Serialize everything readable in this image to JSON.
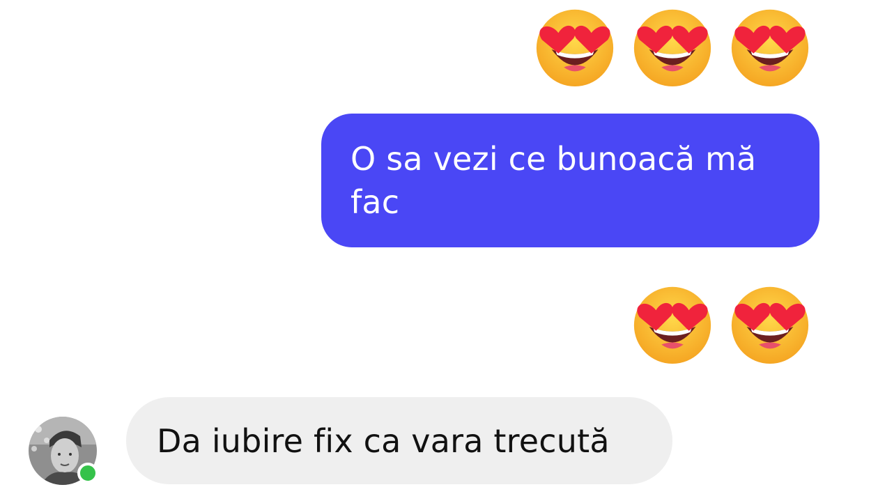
{
  "conversation": {
    "reactions_top": {
      "emoji": [
        "heart-eyes-icon",
        "heart-eyes-icon",
        "heart-eyes-icon"
      ]
    },
    "outgoing_message": {
      "text": "O sa vezi ce bunoacă mă fac"
    },
    "reactions_mid": {
      "emoji": [
        "heart-eyes-icon",
        "heart-eyes-icon"
      ]
    },
    "incoming_message": {
      "text": "Da iubire fix ca vara trecută",
      "sender_online": true
    }
  },
  "colors": {
    "outgoing_bubble": "#4a47f5",
    "incoming_bubble": "#efefef",
    "online_indicator": "#35c24a"
  }
}
